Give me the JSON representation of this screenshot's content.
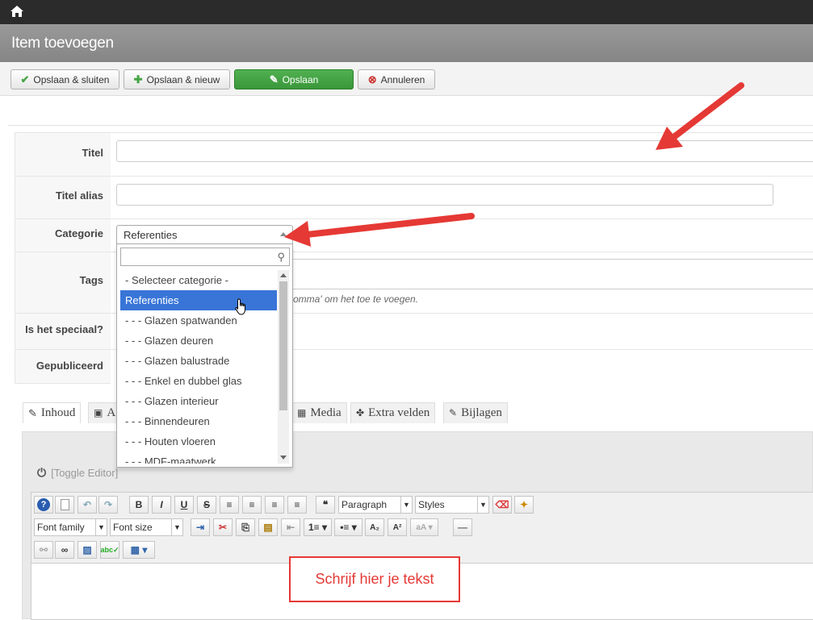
{
  "header": {
    "home_icon": "home-icon"
  },
  "page": {
    "title": "Item toevoegen"
  },
  "toolbar": {
    "save_close": "Opslaan & sluiten",
    "save_new": "Opslaan & nieuw",
    "save": "Opslaan",
    "cancel": "Annuleren"
  },
  "form": {
    "title_label": "Titel",
    "title_value": "",
    "alias_label": "Titel alias",
    "alias_value": "",
    "category_label": "Categorie",
    "category_selected": "Referenties",
    "tags_label": "Tags",
    "tags_hint": "omma' om het toe te voegen.",
    "special_label": "Is het speciaal?",
    "published_label": "Gepubliceerd"
  },
  "category_dropdown": {
    "search_value": "",
    "items": [
      "- Selecteer categorie -",
      "Referenties",
      "- - - Glazen spatwanden",
      "- - - Glazen deuren",
      "- - - Glazen balustrade",
      "- - - Enkel en dubbel glas",
      "- - - Glazen interieur",
      "- - - Binnendeuren",
      "- - - Houten vloeren",
      "- - - MDF-maatwerk"
    ],
    "selected_index": 1
  },
  "tabs": [
    {
      "label": "Inhoud",
      "icon": "edit-icon"
    },
    {
      "label": "A",
      "icon": "image-icon"
    },
    {
      "label": "Media",
      "icon": "film-icon"
    },
    {
      "label": "Extra velden",
      "icon": "puzzle-icon"
    },
    {
      "label": "Bijlagen",
      "icon": "paperclip-icon"
    }
  ],
  "editor": {
    "toggle_label": "[Toggle Editor]",
    "paragraph": "Paragraph",
    "styles": "Styles",
    "font_family": "Font family",
    "font_size": "Font size"
  },
  "annotation": {
    "callout": "Schrijf hier je tekst",
    "color": "#e53935"
  },
  "colors": {
    "accent_green": "#46a546",
    "selection_blue": "#3875d7",
    "arrow_red": "#e53935"
  }
}
